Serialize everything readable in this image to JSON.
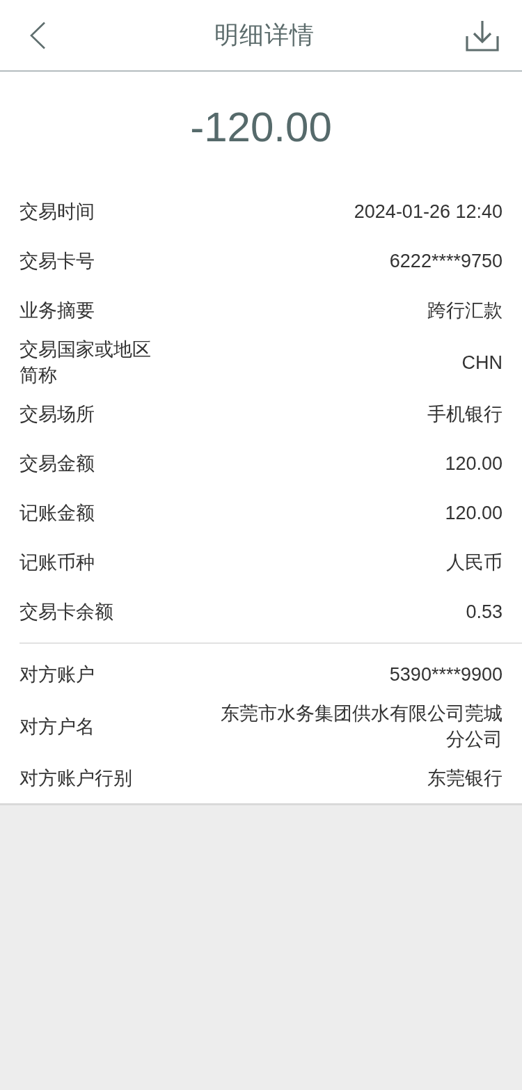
{
  "header": {
    "title": "明细详情"
  },
  "amount": "-120.00",
  "sections": [
    {
      "rows": [
        {
          "label": "交易时间",
          "value": "2024-01-26 12:40"
        },
        {
          "label": "交易卡号",
          "value": "6222****9750"
        },
        {
          "label": "业务摘要",
          "value": "跨行汇款"
        },
        {
          "label": "交易国家或地区简称",
          "value": "CHN"
        },
        {
          "label": "交易场所",
          "value": "手机银行"
        },
        {
          "label": "交易金额",
          "value": "120.00"
        },
        {
          "label": "记账金额",
          "value": "120.00"
        },
        {
          "label": "记账币种",
          "value": "人民币"
        },
        {
          "label": "交易卡余额",
          "value": "0.53"
        }
      ]
    },
    {
      "rows": [
        {
          "label": "对方账户",
          "value": "5390****9900"
        },
        {
          "label": "对方户名",
          "value": "东莞市水务集团供水有限公司莞城分公司"
        },
        {
          "label": "对方账户行别",
          "value": "东莞银行"
        }
      ]
    }
  ]
}
